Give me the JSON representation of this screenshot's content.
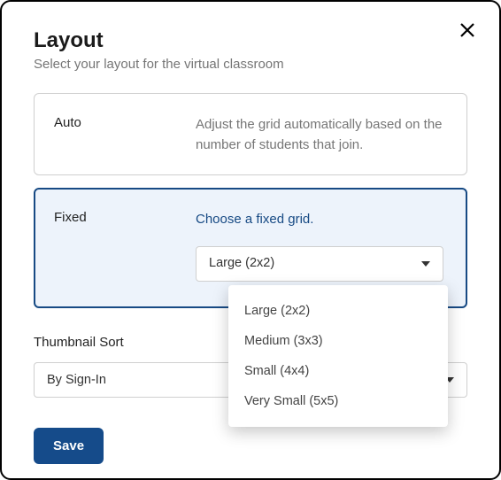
{
  "dialog": {
    "title": "Layout",
    "subtitle": "Select your layout for the virtual classroom"
  },
  "options": {
    "auto": {
      "label": "Auto",
      "description": "Adjust the grid automatically based on the number of students that join."
    },
    "fixed": {
      "label": "Fixed",
      "description": "Choose a fixed grid.",
      "selected_value": "Large (2x2)",
      "menu": [
        "Large (2x2)",
        "Medium (3x3)",
        "Small (4x4)",
        "Very Small (5x5)"
      ]
    }
  },
  "thumbnail_sort": {
    "label": "Thumbnail Sort",
    "selected_value": "By Sign-In"
  },
  "actions": {
    "save": "Save"
  }
}
